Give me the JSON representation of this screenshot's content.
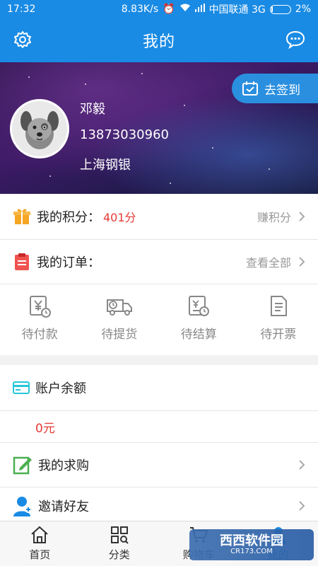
{
  "status_bar": {
    "time": "17:32",
    "speed": "8.83K/s",
    "carrier": "中国联通 3G",
    "battery": "2%"
  },
  "app_bar": {
    "title": "我的",
    "left_icon": "gear-icon",
    "right_icon": "chat-bubble-icon"
  },
  "profile": {
    "name": "邓毅",
    "phone": "13873030960",
    "company": "上海钢银",
    "checkin_label": "去签到"
  },
  "points": {
    "label": "我的积分：",
    "value": "401分",
    "action": "赚积分"
  },
  "orders": {
    "label": "我的订单：",
    "action": "查看全部",
    "tabs": [
      {
        "label": "待付款",
        "icon": "yen-clock-icon"
      },
      {
        "label": "待提货",
        "icon": "truck-clock-icon"
      },
      {
        "label": "待结算",
        "icon": "bill-clock-icon"
      },
      {
        "label": "待开票",
        "icon": "invoice-icon"
      }
    ]
  },
  "balance": {
    "label": "账户余额",
    "value": "0元"
  },
  "purchase": {
    "label": "我的求购"
  },
  "invite": {
    "label": "邀请好友"
  },
  "bottom_nav": [
    {
      "label": "首页",
      "icon": "home-icon"
    },
    {
      "label": "分类",
      "icon": "grid-search-icon"
    },
    {
      "label": "购物车",
      "icon": "cart-icon"
    },
    {
      "label": "我的",
      "icon": "user-icon"
    }
  ],
  "watermark": {
    "text": "西西软件园",
    "sub": "CR173.COM"
  },
  "colors": {
    "primary": "#1a8be4",
    "accent_red": "#e53935",
    "orange": "#f5a623",
    "red_icon": "#ef5350",
    "cyan": "#26c6da",
    "green": "#4caf50"
  }
}
